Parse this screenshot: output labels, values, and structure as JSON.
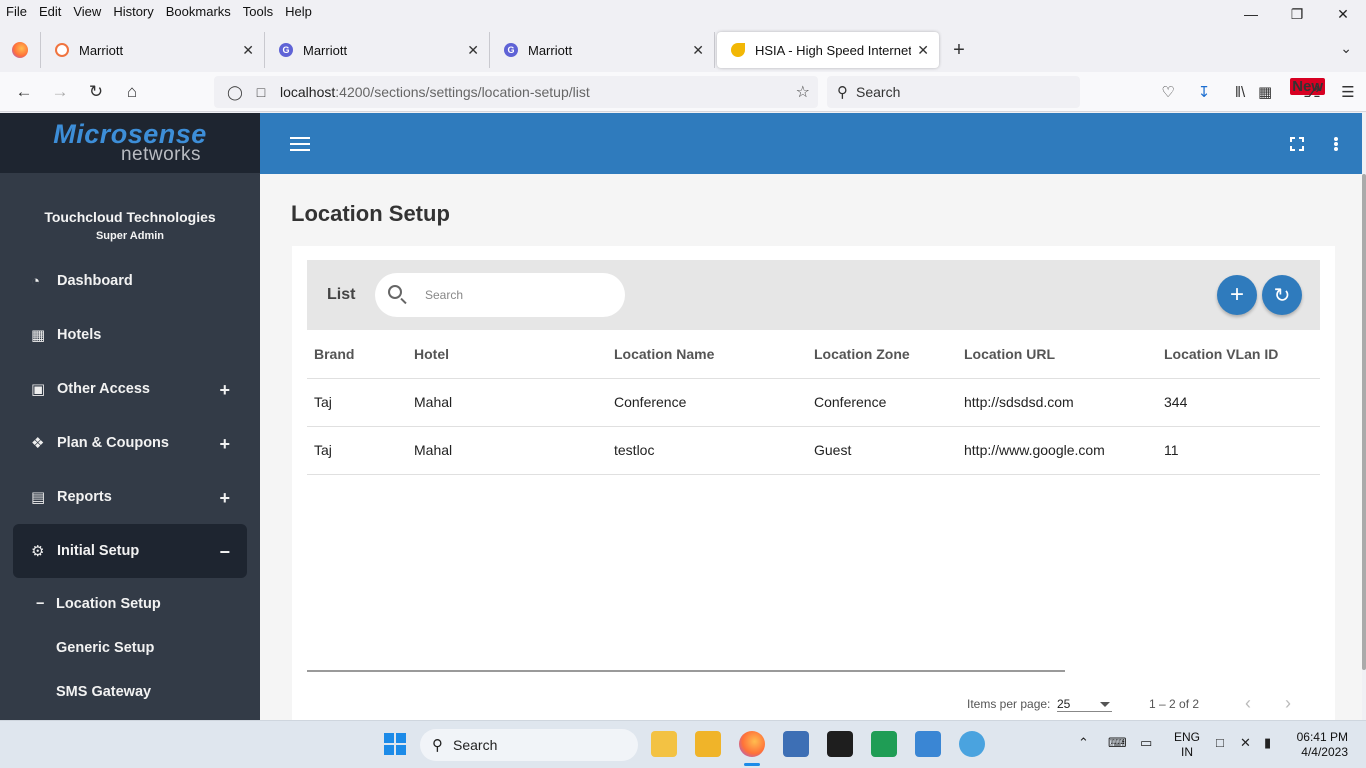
{
  "browser": {
    "menu": [
      "File",
      "Edit",
      "View",
      "History",
      "Bookmarks",
      "Tools",
      "Help"
    ],
    "tabs": [
      {
        "title": "Marriott"
      },
      {
        "title": "Marriott"
      },
      {
        "title": "Marriott"
      },
      {
        "title": "HSIA - High Speed Internet Access"
      }
    ],
    "url_host": "localhost",
    "url_path": ":4200/sections/settings/location-setup/list",
    "search_placeholder": "Search",
    "new_badge": "New"
  },
  "sidebar": {
    "logo_line1": "Microsense",
    "logo_line2": "networks",
    "org": "Touchcloud Technologies",
    "role": "Super Admin",
    "items": [
      {
        "label": "Dashboard",
        "toggle": ""
      },
      {
        "label": "Hotels",
        "toggle": ""
      },
      {
        "label": "Other Access",
        "toggle": "+"
      },
      {
        "label": "Plan & Coupons",
        "toggle": "+"
      },
      {
        "label": "Reports",
        "toggle": "+"
      },
      {
        "label": "Initial Setup",
        "toggle": "−"
      }
    ],
    "subitems": [
      {
        "label": "Location Setup",
        "marker": "−"
      },
      {
        "label": "Generic Setup"
      },
      {
        "label": "SMS Gateway"
      }
    ]
  },
  "main": {
    "title": "Location Setup",
    "list_label": "List",
    "search_placeholder": "Search",
    "columns": [
      "Brand",
      "Hotel",
      "Location Name",
      "Location Zone",
      "Location URL",
      "Location VLan ID"
    ],
    "rows": [
      [
        "Taj",
        "Mahal",
        "Conference",
        "Conference",
        "http://sdsdsd.com",
        "344"
      ],
      [
        "Taj",
        "Mahal",
        "testloc",
        "Guest",
        "http://www.google.com",
        "11"
      ]
    ],
    "pager": {
      "items_per_page_label": "Items per page:",
      "items_per_page": "25",
      "range": "1 – 2 of 2"
    }
  },
  "taskbar": {
    "search": "Search",
    "lang_top": "ENG",
    "lang_bottom": "IN",
    "time": "06:41 PM",
    "date": "4/4/2023"
  },
  "colors": {
    "accent": "#2f7bbd",
    "sidebar_bg": "#333b47",
    "sidebar_dark": "#1e2530"
  }
}
